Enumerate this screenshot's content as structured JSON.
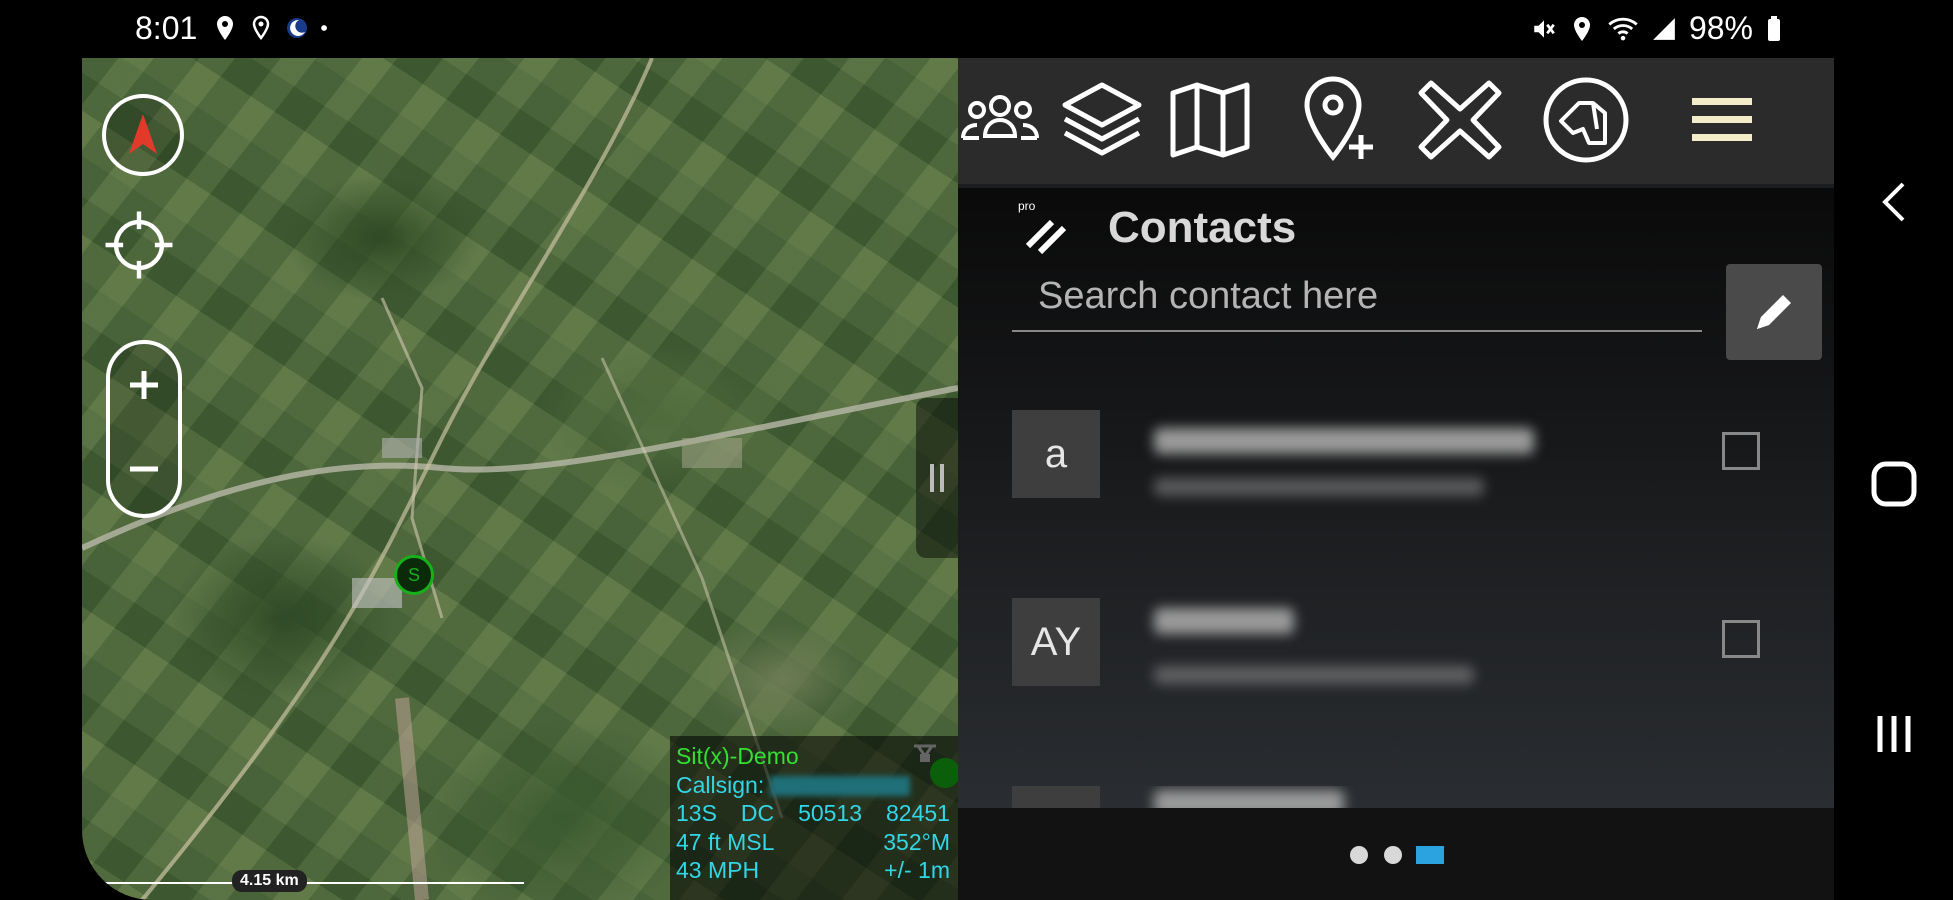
{
  "status_bar": {
    "time": "8:01",
    "battery": "98%",
    "left_icons": [
      "location-pin-icon",
      "location-pin-outline-icon",
      "moon-app-icon",
      "dot-icon"
    ],
    "right_icons": [
      "mute-icon",
      "location-icon",
      "wifi-icon",
      "signal-icon",
      "battery-icon"
    ]
  },
  "map": {
    "self_marker_label": "S",
    "info": {
      "name": "Sit(x)-Demo",
      "callsign_label": "Callsign:",
      "grid_zone": "13S",
      "grid_square": "DC",
      "easting": "50513",
      "northing": "82451",
      "altitude": "47 ft MSL",
      "heading": "352°M",
      "speed": "43 MPH",
      "accuracy": "+/- 1m"
    },
    "scale_label": "4.15 km"
  },
  "toolbar": {
    "icons": [
      "contacts-group-icon",
      "layers-icon",
      "map-icon",
      "add-location-icon",
      "close-x-icon",
      "dog-head-icon",
      "hamburger-menu-icon"
    ]
  },
  "contacts": {
    "title": "Contacts",
    "search_placeholder": "Search contact here",
    "rows": [
      {
        "avatar": "a"
      },
      {
        "avatar": "AY"
      },
      {
        "avatar": ""
      }
    ]
  },
  "pager": {
    "pages": 3,
    "active_page": 3
  },
  "colors": {
    "accent_blue": "#2aa3e0",
    "info_green": "#33e033",
    "info_cyan": "#33d6e6",
    "compass_red": "#e23a2a"
  }
}
